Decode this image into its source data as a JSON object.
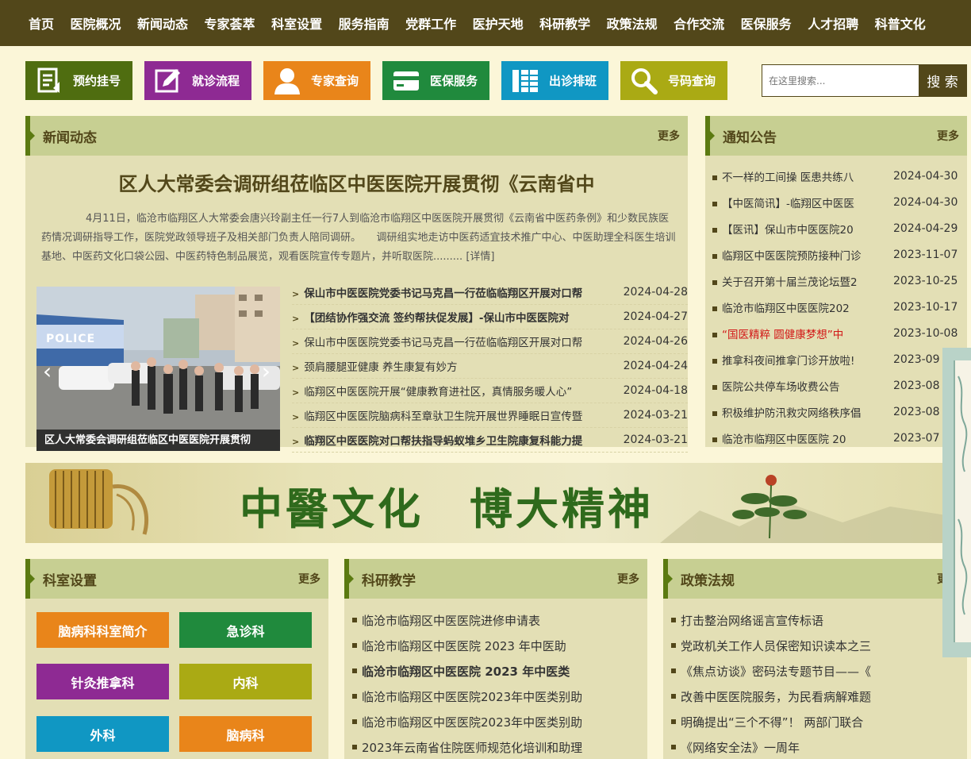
{
  "nav": [
    "首页",
    "医院概况",
    "新闻动态",
    "专家荟萃",
    "科室设置",
    "服务指南",
    "党群工作",
    "医护天地",
    "科研教学",
    "政策法规",
    "合作交流",
    "医保服务",
    "人才招聘",
    "科普文化"
  ],
  "quick": [
    {
      "label": "预约挂号",
      "icon": "register-icon",
      "color": "#4f6d10"
    },
    {
      "label": "就诊流程",
      "icon": "edit-icon",
      "color": "#8e2a93"
    },
    {
      "label": "专家查询",
      "icon": "person-icon",
      "color": "#e9851a"
    },
    {
      "label": "医保服务",
      "icon": "card-icon",
      "color": "#208a3d"
    },
    {
      "label": "出诊排班",
      "icon": "schedule-icon",
      "color": "#1097c3"
    },
    {
      "label": "号码查询",
      "icon": "search-icon",
      "color": "#aaaa14"
    }
  ],
  "search": {
    "placeholder": "在这里搜索...",
    "button": "搜 索"
  },
  "news": {
    "title": "新闻动态",
    "more": "更多",
    "headline": "区人大常委会调研组莅临区中医医院开展贯彻《云南省中",
    "summary": "4月11日，临沧市临翔区人大常委会唐兴玲副主任一行7人到临沧市临翔区中医医院开展贯彻《云南省中医药条例》和少数民族医药情况调研指导工作，医院党政领导班子及相关部门负责人陪同调研。　　调研组实地走访中医药适宜技术推广中心、中医助理全科医生培训基地、中医药文化口袋公园、中医药特色制品展览，观看医院宣传专题片，并听取医院......... [详情]",
    "photo_caption": "区人大常委会调研组莅临区中医医院开展贯彻",
    "photo_sign": "POLICE",
    "items": [
      {
        "text": "保山市中医医院党委书记马克昌一行莅临临翔区开展对口帮",
        "date": "2024-04-28",
        "bold": true
      },
      {
        "text": "【团结协作强交流 签约帮扶促发展】-保山市中医医院对",
        "date": "2024-04-27",
        "bold": true
      },
      {
        "text": "保山市中医医院党委书记马克昌一行莅临临翔区开展对口帮",
        "date": "2024-04-26",
        "bold": false
      },
      {
        "text": "颈肩腰腿亚健康 养生康复有妙方",
        "date": "2024-04-24",
        "bold": false
      },
      {
        "text": "临翔区中医医院开展“健康教育进社区，真情服务暖人心”",
        "date": "2024-04-18",
        "bold": false
      },
      {
        "text": "临翔区中医医院脑病科至章驮卫生院开展世界睡眠日宣传暨",
        "date": "2024-03-21",
        "bold": false
      },
      {
        "text": "临翔区中医医院对口帮扶指导蚂蚁堆乡卫生院康复科能力提",
        "date": "2024-03-21",
        "bold": true
      }
    ]
  },
  "notice": {
    "title": "通知公告",
    "more": "更多",
    "items": [
      {
        "text": "不一样的工间操 医患共练八",
        "date": "2024-04-30",
        "red": false
      },
      {
        "text": "【中医简讯】-临翔区中医医",
        "date": "2024-04-30",
        "red": false
      },
      {
        "text": "【医讯】保山市中医医院20",
        "date": "2024-04-29",
        "red": false
      },
      {
        "text": "临翔区中医医院预防接种门诊",
        "date": "2023-11-07",
        "red": false
      },
      {
        "text": "关于召开第十届兰茂论坛暨2",
        "date": "2023-10-25",
        "red": false
      },
      {
        "text": "临沧市临翔区中医医院202",
        "date": "2023-10-17",
        "red": false
      },
      {
        "text": "“国医精粹 圆健康梦想”中",
        "date": "2023-10-08",
        "red": true
      },
      {
        "text": "推拿科夜间推拿门诊开放啦!",
        "date": "2023-09",
        "red": false
      },
      {
        "text": "医院公共停车场收费公告",
        "date": "2023-08",
        "red": false
      },
      {
        "text": "积极维护防汛救灾网络秩序倡",
        "date": "2023-08",
        "red": false
      },
      {
        "text": "临沧市临翔区中医医院 20",
        "date": "2023-07",
        "red": false
      }
    ]
  },
  "banner": {
    "text": "中醫文化　博大精神"
  },
  "dept": {
    "title": "科室设置",
    "more": "更多",
    "items": [
      {
        "label": "脑病科科室简介",
        "color": "#e9851a"
      },
      {
        "label": "急诊科",
        "color": "#208a3d"
      },
      {
        "label": "针灸推拿科",
        "color": "#8e2a93"
      },
      {
        "label": "内科",
        "color": "#aaaa14"
      },
      {
        "label": "外科",
        "color": "#1097c3"
      },
      {
        "label": "脑病科",
        "color": "#e9851a"
      }
    ]
  },
  "research": {
    "title": "科研教学",
    "more": "更多",
    "items": [
      {
        "text": "临沧市临翔区中医医院进修申请表",
        "bold": false
      },
      {
        "text": "临沧市临翔区中医医院 2023 年中医助",
        "bold": false
      },
      {
        "text": "临沧市临翔区中医医院 2023 年中医类",
        "bold": true
      },
      {
        "text": "临沧市临翔区中医医院2023年中医类别助",
        "bold": false
      },
      {
        "text": "临沧市临翔区中医医院2023年中医类别助",
        "bold": false
      },
      {
        "text": "2023年云南省住院医师规范化培训和助理",
        "bold": false
      }
    ]
  },
  "policy": {
    "title": "政策法规",
    "more": "更多",
    "items": [
      {
        "text": "打击整治网络谣言宣传标语"
      },
      {
        "text": "党政机关工作人员保密知识读本之三"
      },
      {
        "text": "《焦点访谈》密码法专题节目——《"
      },
      {
        "text": "改善中医医院服务，为民看病解难题"
      },
      {
        "text": "明确提出“三个不得”！ 两部门联合"
      },
      {
        "text": "《网络安全法》一周年"
      }
    ]
  }
}
